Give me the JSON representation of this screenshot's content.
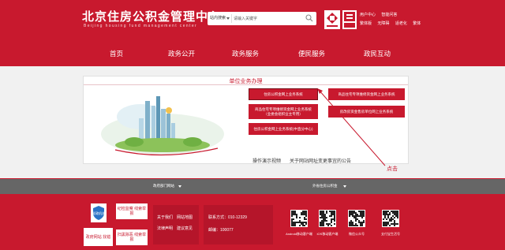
{
  "header": {
    "title": "北京住房公积金管理中心",
    "subtitle": "Beijing housing fund management center",
    "search": {
      "scope": "站内搜索",
      "placeholder": "请输入关键字"
    },
    "links_row1": [
      "用户中心",
      "智能问答"
    ],
    "links_row2": [
      "繁体版",
      "无障碍",
      "适老化",
      "繁体"
    ]
  },
  "nav": [
    "首页",
    "政务公开",
    "政务服务",
    "便民服务",
    "政民互动"
  ],
  "panel": {
    "title": "单位业务办理",
    "buttons": [
      "住房公积金网上业务系统",
      "商品住宅专项维修资金网上业务系统",
      "商品住宅专项维修资金网上业务系统（业委会组织业主专用）",
      "房改房资金售房单位网上业务系统",
      "住房公积金网上业务系统(中直分中心)"
    ],
    "demo_video": "操作演示视频",
    "notice": "关于网站网址变更事宜的公告"
  },
  "annotation": "点击",
  "graybar": {
    "left_select": "政府部门网站",
    "right_select": "外省住房公积金"
  },
  "footer": {
    "badges": [
      "党政机关",
      "纪检监察 线索举报",
      "政府网站 找错",
      "扫黑除恶 线索举报"
    ],
    "links_col1": [
      "关于我们",
      "法律声明"
    ],
    "links_col2": [
      "网站地图",
      "建议意见"
    ],
    "contact_phone": "联系方式：010-12329",
    "postcode": "邮编：100077",
    "qr_labels": [
      "Android移动客户端",
      "iOS移动客户端",
      "微信公众号",
      "支付宝生活号"
    ]
  },
  "colors": {
    "brand": "#c8192e",
    "gray_bar": "#666666",
    "panel_bg": "#f1f1f1"
  }
}
